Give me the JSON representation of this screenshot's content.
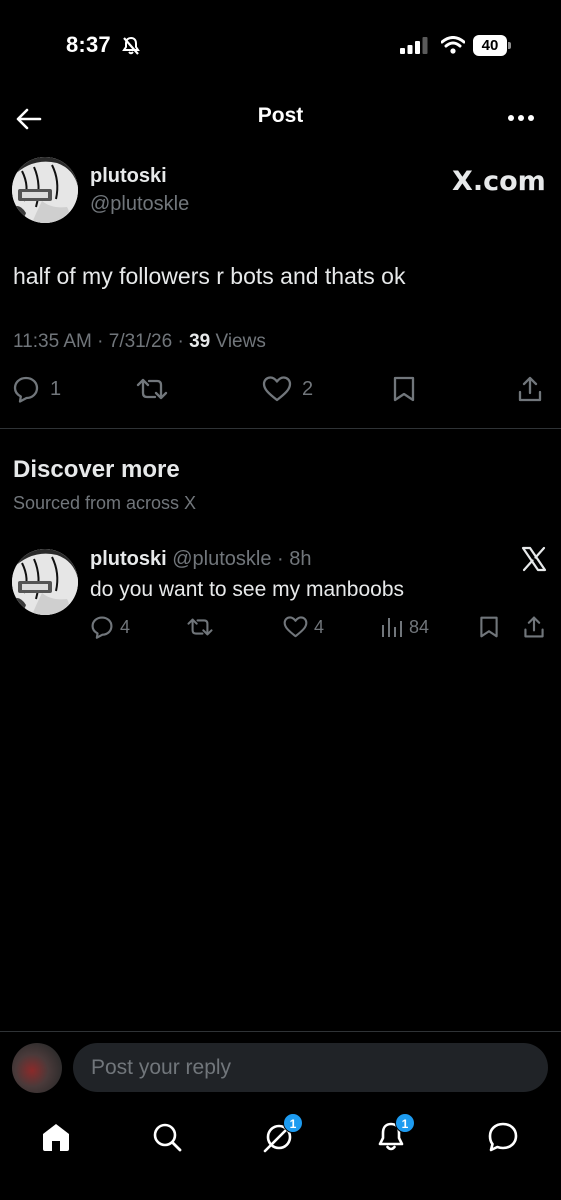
{
  "status_bar": {
    "time": "8:37",
    "battery": "40"
  },
  "header": {
    "title": "Post"
  },
  "post": {
    "display_name": "plutoski",
    "handle": "@plutoskle",
    "source_label": "X.com",
    "text": "half of my followers r bots and thats ok",
    "time": "11:35 AM",
    "date": "7/31/26",
    "views_count": "39",
    "views_label": "Views",
    "reply_count": "1",
    "like_count": "2"
  },
  "discover": {
    "title": "Discover more",
    "subtitle": "Sourced from across X",
    "items": [
      {
        "display_name": "plutoski",
        "handle": "@plutoskle",
        "age": "8h",
        "text": "do you want to see my manboobs",
        "reply_count": "4",
        "like_count": "4",
        "view_count": "84"
      }
    ]
  },
  "reply_bar": {
    "placeholder": "Post your reply"
  },
  "tab_bar": {
    "grok_badge": "1",
    "notifications_badge": "1"
  },
  "colors": {
    "background": "#000000",
    "text_primary": "#e7e9ea",
    "text_secondary": "#71767b",
    "divider": "#2f3336",
    "accent": "#1d9bf0",
    "input_bg": "#202327"
  }
}
